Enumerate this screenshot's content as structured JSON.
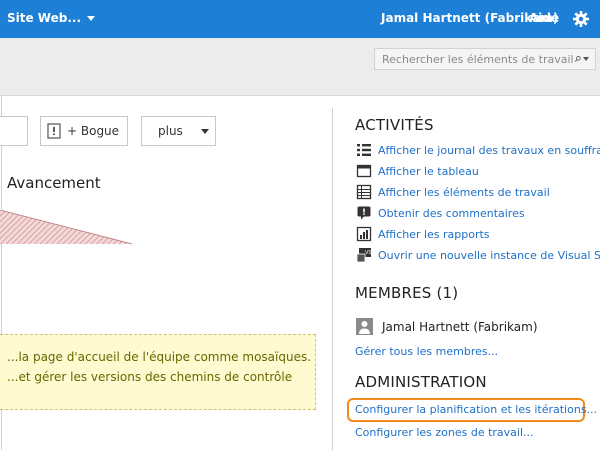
{
  "topbar": {
    "site_label": "Site Web...",
    "user": "Jamal Hartnett (Fabrikam)",
    "help": "Aide",
    "settings_icon": "gear-icon",
    "color": "#1e7fd6"
  },
  "search": {
    "placeholder": "Rechercher les éléments de travail",
    "icon": "search-icon"
  },
  "toolbar": {
    "bug_label": "+ Bogue",
    "more_label": "plus"
  },
  "progress": {
    "title": "Avancement"
  },
  "tips": {
    "line1": "...la page d'accueil de l'équipe comme mosaïques.",
    "line2": "...et gérer les versions des chemins de contrôle"
  },
  "activities": {
    "title": "ACTIVITÉS",
    "items": [
      {
        "label": "Afficher le journal des travaux en souffrance",
        "icon": "backlog-icon"
      },
      {
        "label": "Afficher le tableau",
        "icon": "board-icon"
      },
      {
        "label": "Afficher les éléments de travail",
        "icon": "work-items-icon"
      },
      {
        "label": "Obtenir des commentaires",
        "icon": "feedback-icon"
      },
      {
        "label": "Afficher les rapports",
        "icon": "reports-icon"
      },
      {
        "label": "Ouvrir une nouvelle instance de Visual Studio",
        "icon": "visual-studio-icon"
      }
    ]
  },
  "members": {
    "title": "MEMBRES (1)",
    "list": [
      {
        "name": "Jamal Hartnett (Fabrikam)"
      }
    ],
    "manage_link": "Gérer tous les membres..."
  },
  "administration": {
    "title": "ADMINISTRATION",
    "links": [
      "Configurer la planification et les itérations...",
      "Configurer les zones de travail..."
    ],
    "highlight_color": "#f08a1c"
  }
}
